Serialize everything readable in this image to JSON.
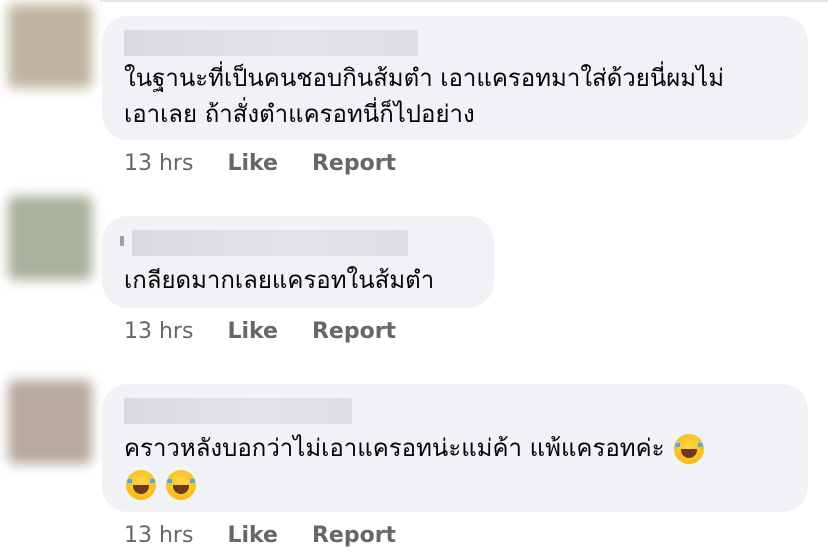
{
  "comments": [
    {
      "name": "",
      "text": "ในฐานะที่เป็นคนชอบกินส้มตำ เอาแครอทมาใส่ด้วยนี่ผมไม่เอาเลย ถ้าสั่งตำแครอทนี่ก็ไปอย่าง",
      "time": "13 hrs",
      "like_label": "Like",
      "report_label": "Report",
      "avatar_color": "#bfb49f"
    },
    {
      "name": "",
      "text": "เกลียดมากเลยแครอทในส้มตำ",
      "time": "13 hrs",
      "like_label": "Like",
      "report_label": "Report",
      "avatar_color": "#a9b09c"
    },
    {
      "name": "",
      "text": "คราวหลังบอกว่าไม่เอาแครอทน่ะแม่ค้า แพ้แครอทค่ะ",
      "emoji_icon": "face-with-tears-of-joy",
      "time": "13 hrs",
      "like_label": "Like",
      "report_label": "Report",
      "avatar_color": "#b8a89e"
    }
  ]
}
